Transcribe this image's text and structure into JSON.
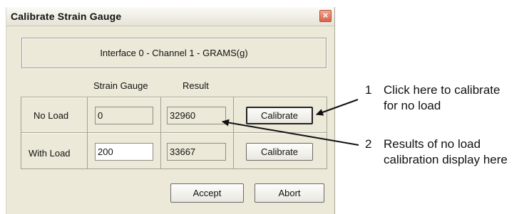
{
  "dialog": {
    "title": "Calibrate Strain Gauge",
    "close_symbol": "×",
    "info_text": "Interface 0 - Channel 1 - GRAMS(g)",
    "columns": {
      "strain_gauge": "Strain Gauge",
      "result": "Result"
    },
    "rows": {
      "no_load": {
        "label": "No Load",
        "strain_gauge": "0",
        "result": "32960",
        "button": "Calibrate"
      },
      "with_load": {
        "label": "With Load",
        "strain_gauge": "200",
        "result": "33667",
        "button": "Calibrate"
      }
    },
    "footer": {
      "accept": "Accept",
      "abort": "Abort"
    }
  },
  "annotations": [
    {
      "number": "1",
      "line1": "Click here to calibrate",
      "line2": "for no load"
    },
    {
      "number": "2",
      "line1": "Results of no load",
      "line2": "calibration display here"
    }
  ]
}
